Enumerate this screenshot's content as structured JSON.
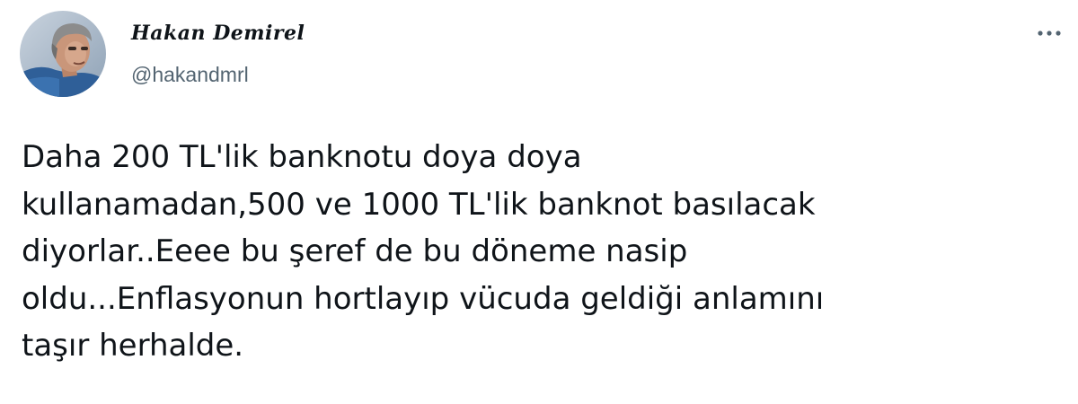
{
  "tweet": {
    "author": {
      "display_name": "Hakan Demirel",
      "handle": "@hakandmrl",
      "avatar_icon": "profile-photo"
    },
    "more_icon": "more-horizontal-icon",
    "text_lines": [
      "Daha 200 TL'lik banknotu doya doya",
      "kullanamadan,500 ve 1000 TL'lik banknot basılacak",
      "diyorlar..Eeee bu şeref de bu döneme nasip",
      "oldu...Enflasyonun hortlayıp vücuda geldiği anlamını",
      "taşır herhalde."
    ]
  },
  "colors": {
    "text": "#0f1419",
    "secondary_text": "#536471",
    "background": "#ffffff"
  }
}
